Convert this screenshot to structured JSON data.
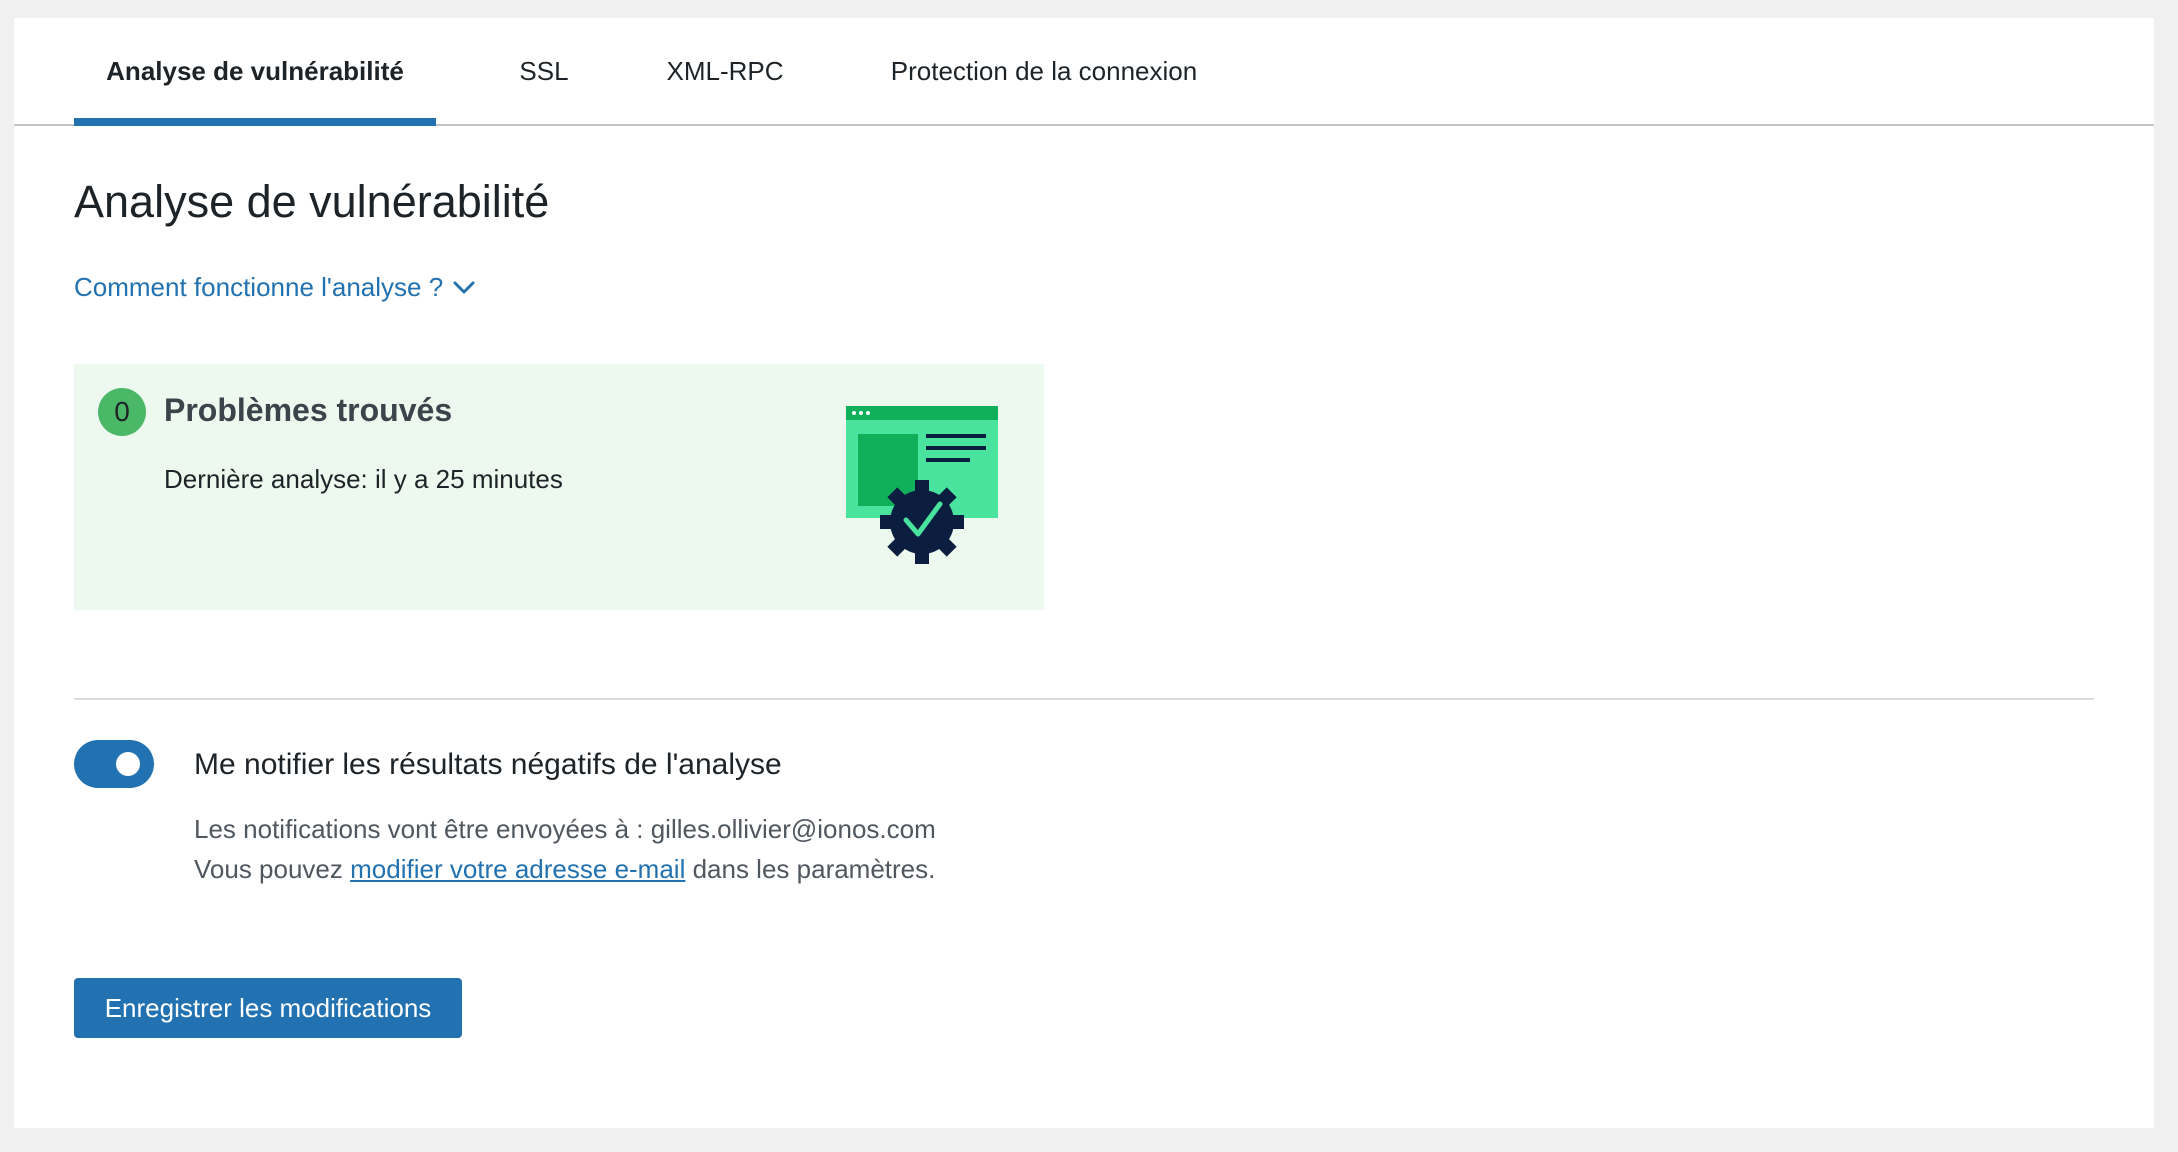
{
  "tabs": [
    {
      "label": "Analyse de vulnérabilité",
      "active": true
    },
    {
      "label": "SSL",
      "active": false
    },
    {
      "label": "XML-RPC",
      "active": false
    },
    {
      "label": "Protection de la connexion",
      "active": false
    }
  ],
  "page_title": "Analyse de vulnérabilité",
  "how_link": {
    "label": "Comment fonctionne l'analyse ?",
    "icon": "chevron-down-icon"
  },
  "result_card": {
    "count": "0",
    "title": "Problèmes trouvés",
    "last_scan": "Dernière analyse: il y a 25 minutes",
    "illustration": "website-shield-check-illustration"
  },
  "notification": {
    "toggle_on": true,
    "label": "Me notifier les résultats négatifs de l'analyse",
    "line1": "Les notifications vont être envoyées à : gilles.ollivier@ionos.com",
    "line2_prefix": "Vous pouvez ",
    "line2_link": "modifier votre adresse e-mail",
    "line2_suffix": " dans les paramètres."
  },
  "save_button": "Enregistrer les modifications",
  "colors": {
    "accent": "#2271b1",
    "success": "#4ab866",
    "card_bg": "#edf8ee",
    "page_bg": "#f0f0f1"
  }
}
